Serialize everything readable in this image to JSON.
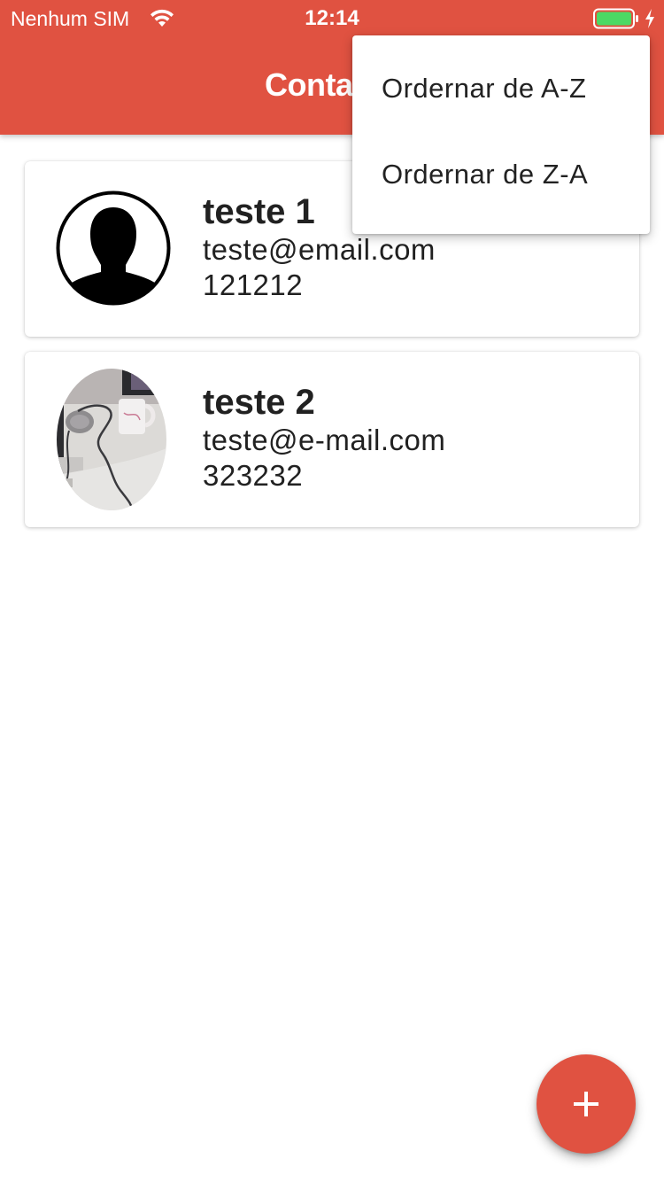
{
  "status_bar": {
    "carrier": "Nenhum SIM",
    "time": "12:14",
    "wifi_icon": "wifi-icon",
    "battery_icon": "battery-icon",
    "charging_icon": "charging-bolt-icon",
    "battery_level": 1.0,
    "battery_color": "#4cd964"
  },
  "app_bar": {
    "title": "Contatos",
    "background_color": "#e05241"
  },
  "contacts": [
    {
      "name": "teste 1",
      "email": "teste@email.com",
      "phone": "121212",
      "avatar": "default-person-icon"
    },
    {
      "name": "teste 2",
      "email": "teste@e-mail.com",
      "phone": "323232",
      "avatar": "contact-photo"
    }
  ],
  "popup_menu": {
    "items": [
      {
        "label": "Ordernar de A-Z"
      },
      {
        "label": "Ordernar de Z-A"
      }
    ]
  },
  "fab": {
    "icon": "add-icon",
    "color": "#e05241"
  }
}
